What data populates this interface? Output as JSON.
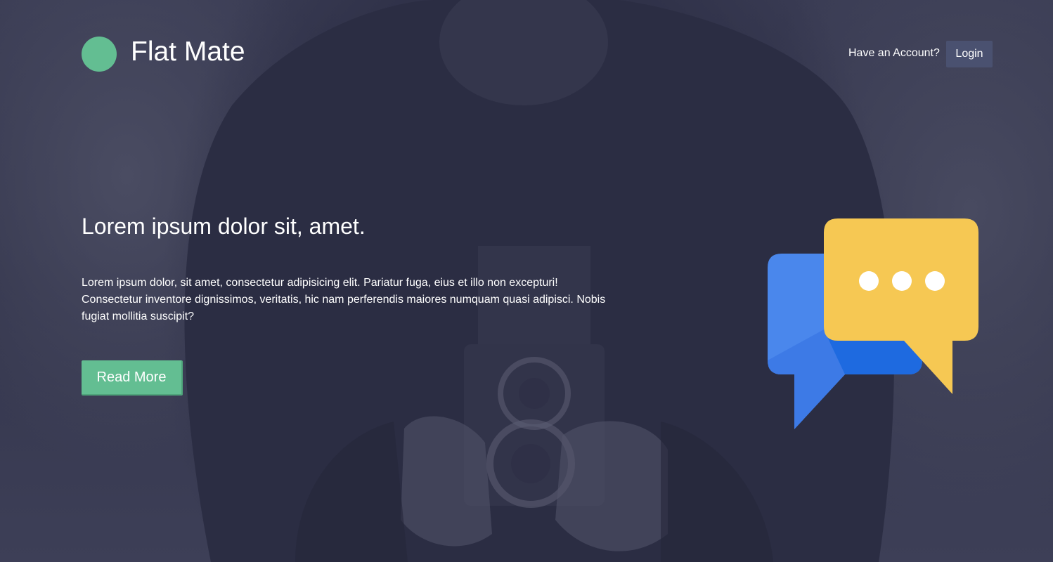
{
  "header": {
    "brand": "Flat Mate",
    "account_prompt": "Have an Account?",
    "login_label": "Login"
  },
  "hero": {
    "headline": "Lorem ipsum dolor sit, amet.",
    "body": "Lorem ipsum dolor, sit amet, consectetur adipisicing elit. Pariatur fuga, eius et illo non excepturi! Consectetur inventore dignissimos, veritatis, hic nam perferendis maiores numquam quasi adipisci. Nobis fugiat mollitia suscipit?",
    "cta_label": "Read More"
  },
  "colors": {
    "accent": "#63be92",
    "login_bg": "#4a5170",
    "overlay": "#2d2f46",
    "bubble_blue": "#4a87ec",
    "bubble_yellow": "#f6c853"
  },
  "icons": {
    "logo": "logo-circle-icon",
    "illustration": "chat-bubbles-icon"
  }
}
